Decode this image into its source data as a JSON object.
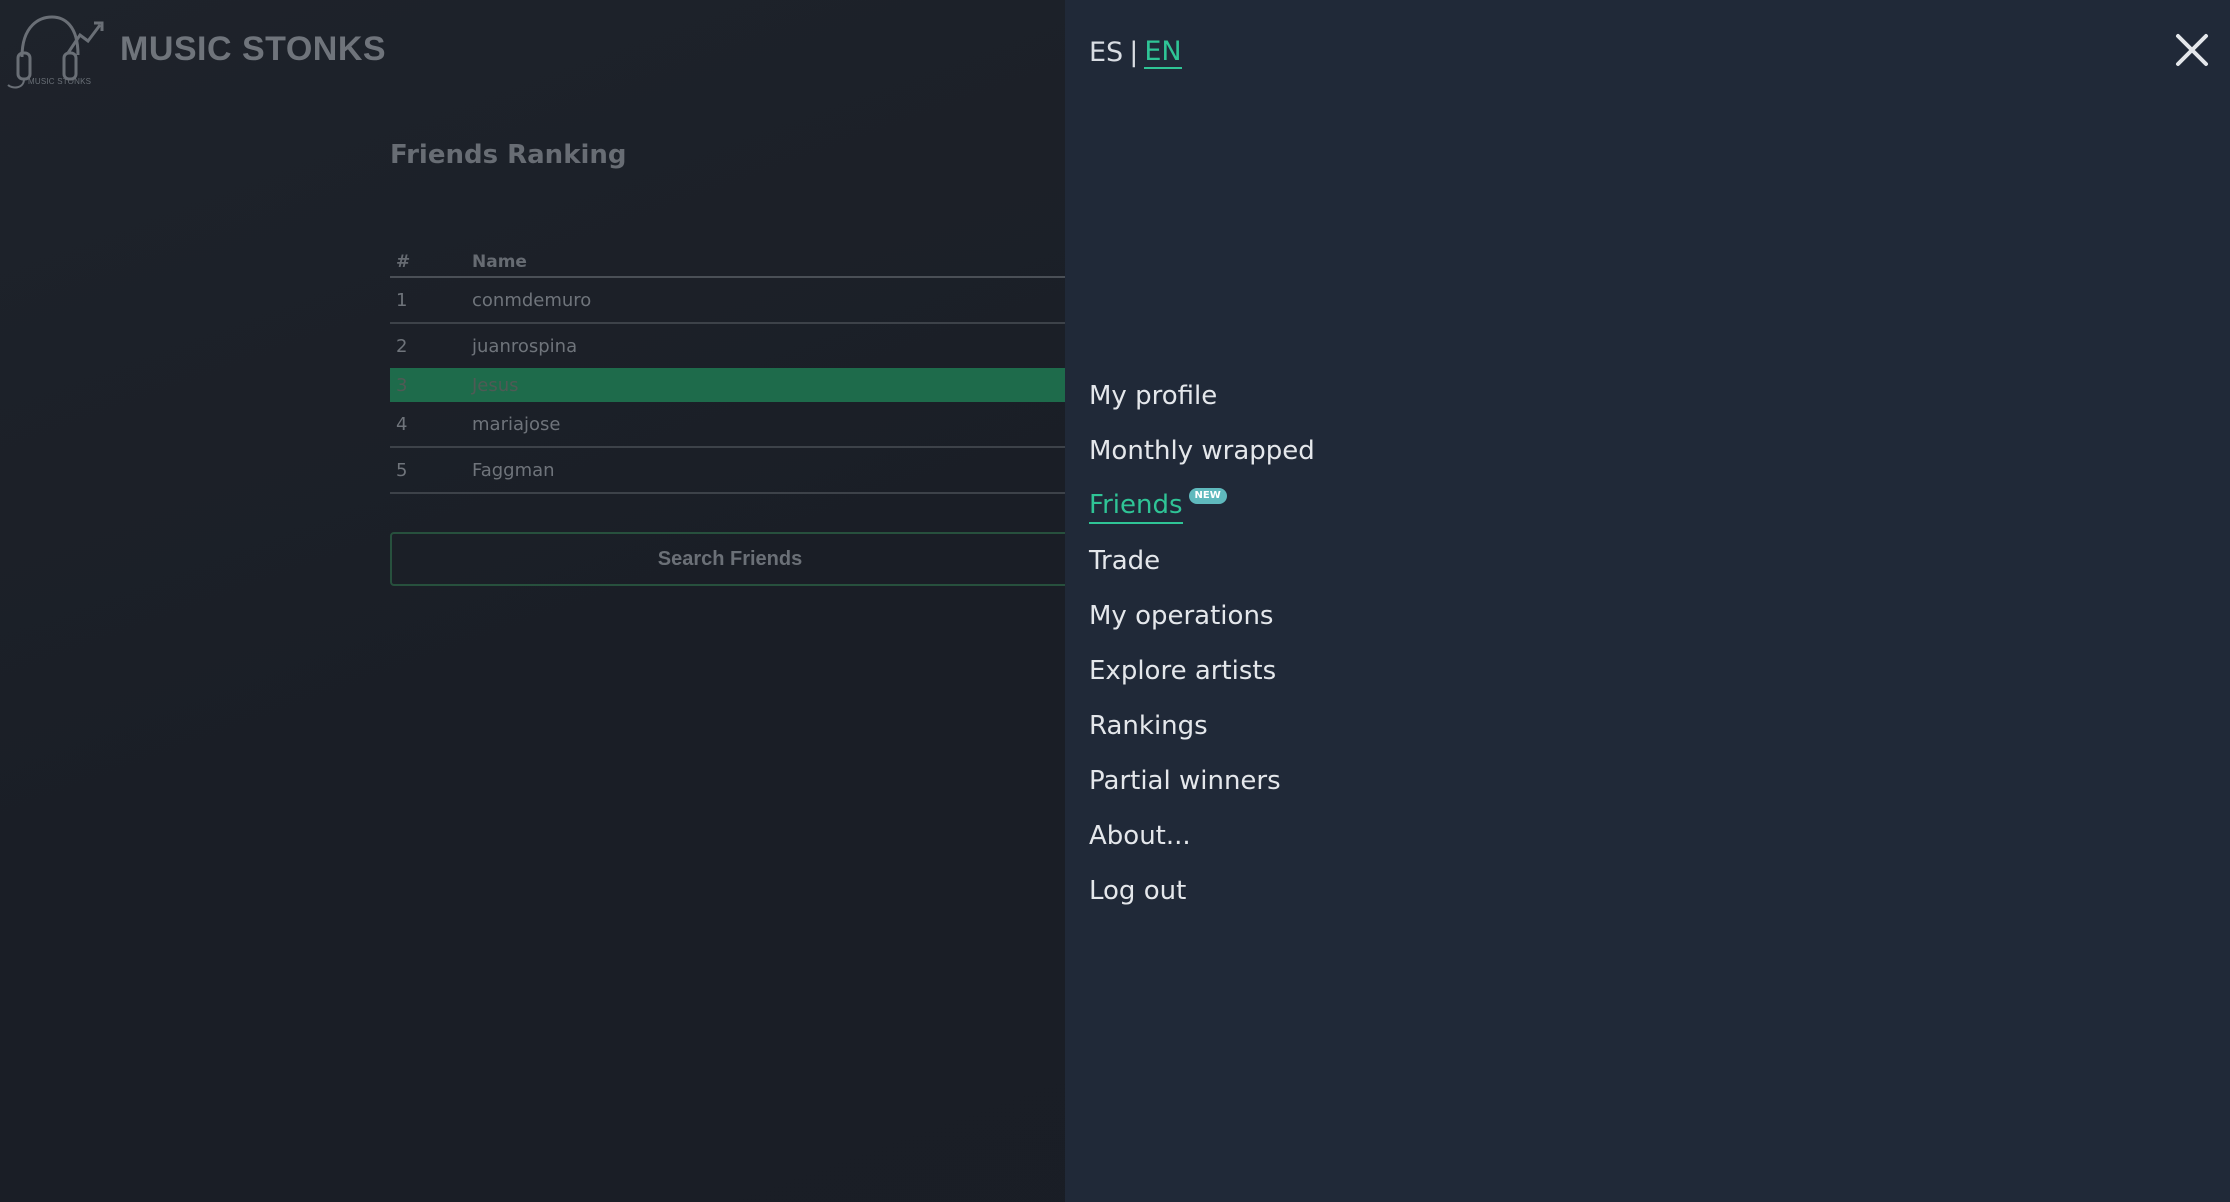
{
  "header": {
    "brand": "MUSIC STONKS",
    "logo_caption": "MUSIC STONKS",
    "logo_icon": "headphones-chart-icon"
  },
  "main": {
    "title": "Friends Ranking",
    "table": {
      "columns": [
        "#",
        "Name"
      ],
      "rows": [
        {
          "rank": "1",
          "name": "conmdemuro"
        },
        {
          "rank": "2",
          "name": "juanrospina"
        },
        {
          "rank": "3",
          "name": "Jesus"
        },
        {
          "rank": "4",
          "name": "mariajose"
        },
        {
          "rank": "5",
          "name": "Faggman"
        }
      ]
    },
    "search_button": "Search Friends"
  },
  "drawer": {
    "lang": {
      "es": "ES",
      "separator": "|",
      "en": "EN"
    },
    "close_icon": "close-icon",
    "menu": [
      {
        "label": "My profile"
      },
      {
        "label": "Monthly wrapped"
      },
      {
        "label": "Friends",
        "badge": "NEW"
      },
      {
        "label": "Trade"
      },
      {
        "label": "My operations"
      },
      {
        "label": "Explore artists"
      },
      {
        "label": "Rankings"
      },
      {
        "label": "Partial winners"
      },
      {
        "label": "About..."
      },
      {
        "label": "Log out"
      }
    ]
  },
  "colors": {
    "accent": "#2fc496",
    "highlight_row": "#1e6b4b",
    "drawer_bg": "#202938",
    "badge": "#5fb9bd"
  }
}
